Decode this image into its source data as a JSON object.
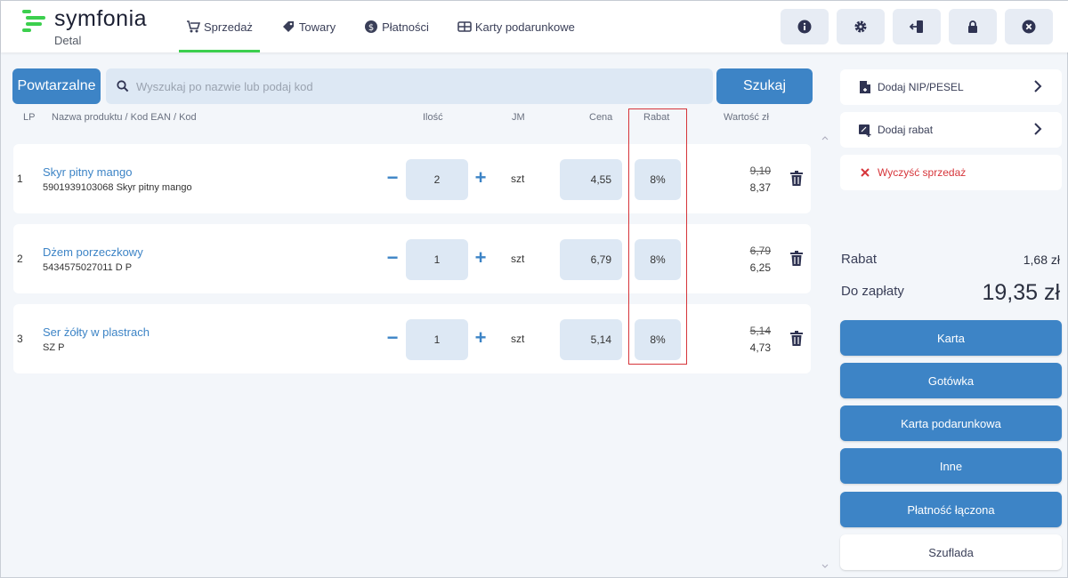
{
  "app": {
    "logo_text": "symfonia",
    "logo_sub": "Detal"
  },
  "nav": [
    {
      "label": "Sprzedaż",
      "icon": "cart-icon",
      "active": true
    },
    {
      "label": "Towary",
      "icon": "tag-icon",
      "active": false
    },
    {
      "label": "Płatności",
      "icon": "dollar-circle-icon",
      "active": false
    },
    {
      "label": "Karty podarunkowe",
      "icon": "gift-card-icon",
      "active": false
    }
  ],
  "header_buttons": [
    "info-icon",
    "gear-icon",
    "logout-icon",
    "lock-icon",
    "close-circle-icon"
  ],
  "search": {
    "recurring_label": "Powtarzalne",
    "placeholder": "Wyszukaj po nazwie lub podaj kod",
    "search_label": "Szukaj"
  },
  "columns": {
    "lp": "LP",
    "name": "Nazwa produktu / Kod EAN / Kod",
    "qty": "Ilość",
    "jm": "JM",
    "price": "Cena",
    "rabat": "Rabat",
    "value": "Wartość zł"
  },
  "rows": [
    {
      "lp": "1",
      "name": "Skyr pitny mango",
      "code": "5901939103068 Skyr pitny mango",
      "qty": "2",
      "jm": "szt",
      "price": "4,55",
      "rabat": "8%",
      "old_value": "9,10",
      "new_value": "8,37"
    },
    {
      "lp": "2",
      "name": "Dżem porzeczkowy",
      "code": "5434575027011 D P",
      "qty": "1",
      "jm": "szt",
      "price": "6,79",
      "rabat": "8%",
      "old_value": "6,79",
      "new_value": "6,25"
    },
    {
      "lp": "3",
      "name": "Ser żółty w plastrach",
      "code": "SZ P",
      "qty": "1",
      "jm": "szt",
      "price": "5,14",
      "rabat": "8%",
      "old_value": "5,14",
      "new_value": "4,73"
    }
  ],
  "side": {
    "add_nip": "Dodaj NIP/PESEL",
    "add_discount": "Dodaj rabat",
    "clear_sale": "Wyczyść sprzedaż",
    "rabat_label": "Rabat",
    "rabat_value": "1,68 zł",
    "to_pay_label": "Do zapłaty",
    "to_pay_value": "19,35 zł"
  },
  "payments": {
    "card": "Karta",
    "cash": "Gotówka",
    "gift_card": "Karta podarunkowa",
    "other": "Inne",
    "combined": "Płatność łączona",
    "drawer": "Szuflada"
  },
  "colors": {
    "accent": "#3d84c6",
    "brand_green": "#3ccf4e",
    "highlight_red": "#d6353a",
    "field_bg": "#dde8f4"
  }
}
